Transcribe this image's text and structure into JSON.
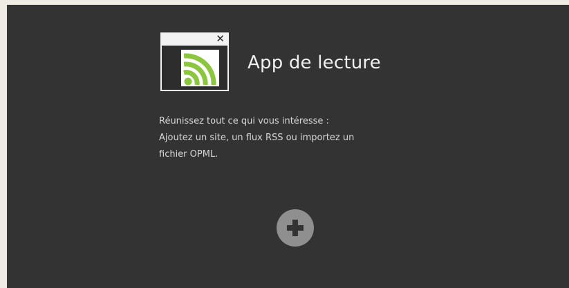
{
  "app": {
    "title": "App de lecture",
    "icon": "rss-feed-icon",
    "close_glyph": "✕"
  },
  "description": {
    "line1": "Réunissez tout ce qui vous intéresse :",
    "line2": "Ajoutez un site, un flux RSS ou importez un",
    "line3": "fichier OPML."
  },
  "actions": {
    "add_icon": "plus-icon"
  },
  "colors": {
    "background": "#333333",
    "accent_rss": "#8cc63f",
    "button": "#8f8f8f"
  }
}
